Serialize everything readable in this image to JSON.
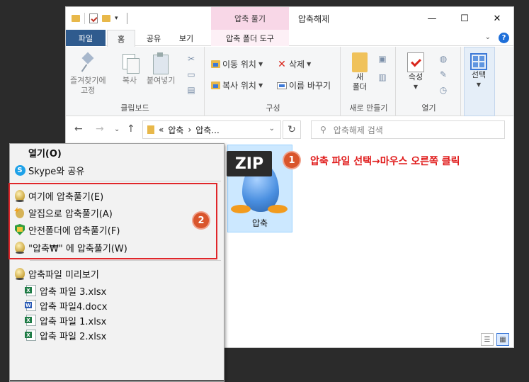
{
  "titlebar": {
    "context_tab_header": "압축 풀기",
    "window_title": "압축해제",
    "minimize": "—",
    "maximize": "☐",
    "close": "✕"
  },
  "tabs": {
    "file": "파일",
    "home": "홈",
    "share": "공유",
    "view": "보기",
    "tools": "압축 폴더 도구"
  },
  "ribbon": {
    "clipboard": {
      "label": "클립보드",
      "pin_line1": "즐겨찾기에",
      "pin_line2": "고정",
      "copy": "복사",
      "paste": "붙여넣기"
    },
    "organize": {
      "label": "구성",
      "move_to": "이동 위치",
      "copy_to": "복사 위치",
      "delete": "삭제",
      "rename": "이름 바꾸기"
    },
    "new": {
      "label": "새로 만들기",
      "new_folder_line1": "새",
      "new_folder_line2": "폴더"
    },
    "open": {
      "label": "열기",
      "properties": "속성"
    },
    "select": {
      "label": "선택"
    }
  },
  "address": {
    "prefix": "«",
    "crumb1": "압축",
    "separator": "›",
    "crumb2": "압축...",
    "search_placeholder": "압축해제 검색"
  },
  "content": {
    "zip_badge": "ZIP",
    "zip_name": "압축"
  },
  "annotation": {
    "badge1": "1",
    "badge2": "2",
    "text": "압축 파일 선택→마우스 오른쪽 클릭"
  },
  "context_menu": {
    "open": "열기(O)",
    "skype": "Skype와 공유",
    "extract_here": "여기에 압축풀기(E)",
    "alzip_extract": "알집으로 압축풀기(A)",
    "safe_extract": "안전폴더에 압축풀기(F)",
    "extract_to": "\"압축₩\" 에 압축풀기(W)",
    "preview": "압축파일 미리보기",
    "files": [
      {
        "name": "압축 파일 3.xlsx",
        "type": "x"
      },
      {
        "name": "압축 파일4.docx",
        "type": "w"
      },
      {
        "name": "압축 파일 1.xlsx",
        "type": "x"
      },
      {
        "name": "압축 파일 2.xlsx",
        "type": "x"
      }
    ]
  },
  "colors": {
    "accent": "#2f5b8e",
    "annotation_red": "#e01b1b",
    "selection": "#cce8ff"
  }
}
